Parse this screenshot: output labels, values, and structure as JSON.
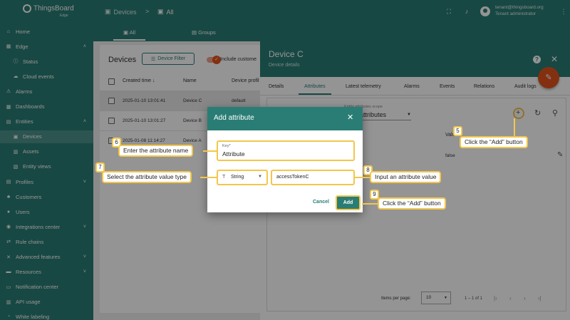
{
  "app": {
    "logo_name": "ThingsBoard",
    "logo_sub": "Edge",
    "breadcrumb": [
      "Devices",
      "All"
    ],
    "user_email": "tenant@thingsboard.org",
    "user_role": "Tenant administrator"
  },
  "sidebar": {
    "items": [
      {
        "label": "Home",
        "icon": "home-icon",
        "glyph": "⌂"
      },
      {
        "label": "Edge",
        "icon": "edge-icon",
        "glyph": "▦",
        "chevron": "˄"
      },
      {
        "label": "Status",
        "icon": "info-icon",
        "glyph": "ⓘ"
      },
      {
        "label": "Cloud events",
        "icon": "cloud-icon",
        "glyph": "☁"
      },
      {
        "label": "Alarms",
        "icon": "alarm-icon",
        "glyph": "⚠"
      },
      {
        "label": "Dashboards",
        "icon": "dashboard-icon",
        "glyph": "▦"
      },
      {
        "label": "Entities",
        "icon": "entities-icon",
        "glyph": "▤",
        "chevron": "˄"
      },
      {
        "label": "Devices",
        "icon": "devices-icon",
        "glyph": "▣"
      },
      {
        "label": "Assets",
        "icon": "assets-icon",
        "glyph": "▥"
      },
      {
        "label": "Entity views",
        "icon": "entity-views-icon",
        "glyph": "▧"
      },
      {
        "label": "Profiles",
        "icon": "profiles-icon",
        "glyph": "▤",
        "chevron": "˅"
      },
      {
        "label": "Customers",
        "icon": "customers-icon",
        "glyph": "♣"
      },
      {
        "label": "Users",
        "icon": "users-icon",
        "glyph": "●"
      },
      {
        "label": "Integrations center",
        "icon": "integrations-icon",
        "glyph": "◉",
        "chevron": "˅"
      },
      {
        "label": "Rule chains",
        "icon": "rule-chains-icon",
        "glyph": "⇄"
      },
      {
        "label": "Advanced features",
        "icon": "advanced-icon",
        "glyph": "✕",
        "chevron": "˅"
      },
      {
        "label": "Resources",
        "icon": "resources-icon",
        "glyph": "▬",
        "chevron": "˅"
      },
      {
        "label": "Notification center",
        "icon": "notification-icon",
        "glyph": "▭"
      },
      {
        "label": "API usage",
        "icon": "api-usage-icon",
        "glyph": "▥"
      },
      {
        "label": "White labeling",
        "icon": "white-labeling-icon",
        "glyph": "◔"
      }
    ]
  },
  "main_tabs": [
    "All",
    "Groups"
  ],
  "devices": {
    "title": "Devices",
    "filter_label": "Device Filter",
    "include_label": "Include custome",
    "columns": [
      "Created time",
      "Name",
      "Device profil"
    ],
    "sort_arrow": "↓",
    "rows": [
      {
        "created": "2025-01-10 13:01:41",
        "name": "Device C",
        "profile": "default"
      },
      {
        "created": "2025-01-10 13:01:27",
        "name": "Device B",
        "profile": ""
      },
      {
        "created": "2025-01-08 11:14:27",
        "name": "Device A",
        "profile": ""
      }
    ]
  },
  "detail": {
    "title": "Device C",
    "subtitle": "Device details",
    "tabs": [
      "Details",
      "Attributes",
      "Latest telemetry",
      "Alarms",
      "Events",
      "Relations",
      "Audit logs"
    ],
    "scope_label": "Entity attributes scope",
    "scope_value": "attributes",
    "value_column": "Value",
    "value_cell": "false",
    "items_per_page_label": "Items per page:",
    "items_per_page": "10",
    "range": "1 – 1 of 1"
  },
  "dialog": {
    "title": "Add attribute",
    "key_label": "Key*",
    "key_value": "Attribute",
    "type_value": "String",
    "value_value": "accessTokenC",
    "cancel_label": "Cancel",
    "add_label": "Add"
  },
  "callouts": [
    {
      "num": "5",
      "text": "Click the “Add” button"
    },
    {
      "num": "6",
      "text": "Enter the attribute name"
    },
    {
      "num": "7",
      "text": "Select the attribute value type"
    },
    {
      "num": "8",
      "text": "Input an attribute value"
    },
    {
      "num": "9",
      "text": "Click the “Add” button"
    }
  ],
  "colors": {
    "primary": "#2a7d74",
    "accent": "#e2531e",
    "highlight": "#f3c64c"
  }
}
